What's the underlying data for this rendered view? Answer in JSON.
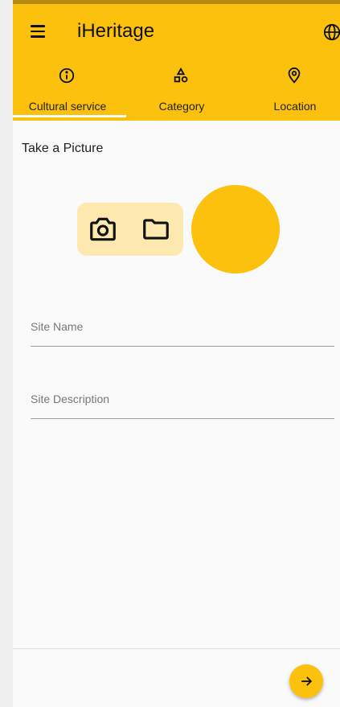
{
  "app": {
    "title": "iHeritage"
  },
  "icons": {
    "menu": "menu-icon",
    "globe": "globe-icon",
    "camera": "camera-icon",
    "folder": "folder-icon",
    "next": "arrow-right-icon"
  },
  "colors": {
    "primary": "#fcc10d",
    "picker_background": "#fde9b0",
    "background": "#fafafa",
    "text": "#222222"
  },
  "tabs": [
    {
      "label": "Cultural service",
      "icon": "info-icon",
      "selected": true
    },
    {
      "label": "Category",
      "icon": "category-icon",
      "selected": false
    },
    {
      "label": "Location",
      "icon": "location-pin-icon",
      "selected": false
    }
  ],
  "form": {
    "section_title": "Take a Picture",
    "site_name": {
      "placeholder": "Site Name",
      "value": ""
    },
    "site_description": {
      "placeholder": "Site Description",
      "value": ""
    }
  }
}
